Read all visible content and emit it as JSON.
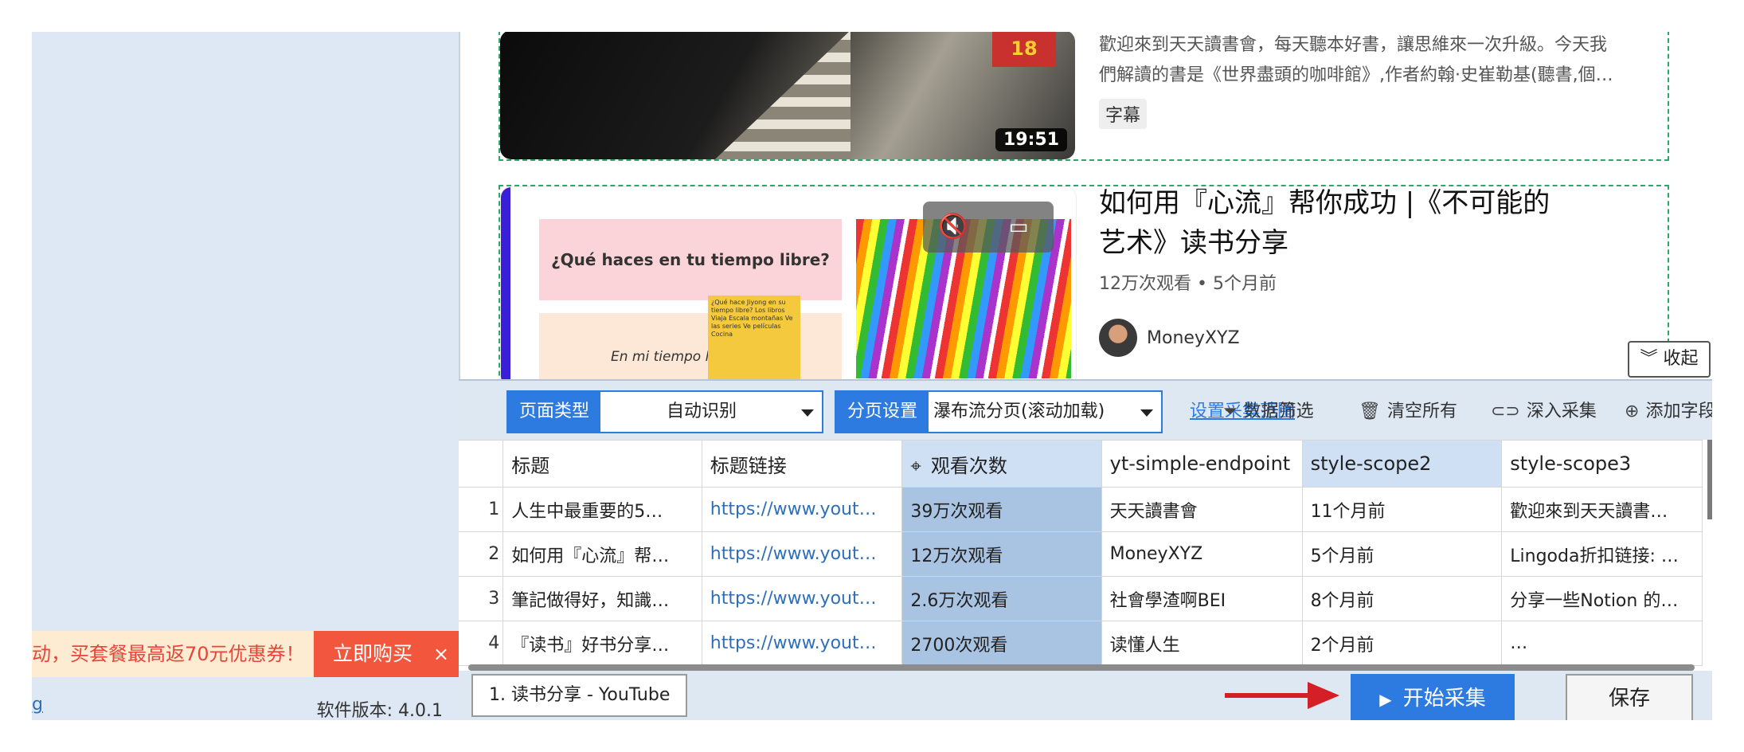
{
  "left_panel": {
    "promo_text": "动，买套餐最高返70元优惠券！",
    "promo_button": "立即购买",
    "promo_close": "×",
    "link_text": "g",
    "version": "软件版本: 4.0.1"
  },
  "videos": [
    {
      "duration": "19:51",
      "book_badge": "18",
      "description_line1": "歡迎來到天天讀書會，每天聽本好書，讓思維來一次升級。今天我",
      "description_line2": "們解讀的書是《世界盡頭的咖啡館》,作者約翰·史崔勒基(聽書,個…",
      "tag": "字幕"
    },
    {
      "title_line1": "如何用『心流』帮你成功 |《不可能的",
      "title_line2": "艺术》读书分享",
      "views": "12万次观看",
      "age": "• 5个月前",
      "channel": "MoneyXYZ",
      "slide_question": "¿Qué haces en tu tiempo libre?",
      "slide_answer": "En mi tiempo li",
      "note_text": "¿Qué hace Jiyong en su tiempo libre? Los libros Viaja Escala montañas Ve las series Ve películas Cocina"
    }
  ],
  "collapse_button": "收起",
  "toolbar": {
    "page_type_label": "页面类型",
    "page_type_value": "自动识别",
    "paging_label": "分页设置",
    "paging_value": "瀑布流分页(滚动加载)",
    "settings_link": "设置采集范围",
    "filter": "数据筛选",
    "clear": "清空所有",
    "deep": "深入采集",
    "add_field": "添加字段"
  },
  "table": {
    "columns": [
      "",
      "标题",
      "标题链接",
      "观看次数",
      "yt-simple-endpoint",
      "style-scope2",
      "style-scope3"
    ],
    "rows": [
      [
        "1",
        "人生中最重要的5…",
        "https://www.yout…",
        "39万次观看",
        "天天讀書會",
        "11个月前",
        "歡迎來到天天讀書…"
      ],
      [
        "2",
        "如何用『心流』帮…",
        "https://www.yout…",
        "12万次观看",
        "MoneyXYZ",
        "5个月前",
        "Lingoda折扣链接: …"
      ],
      [
        "3",
        "筆記做得好，知識…",
        "https://www.yout…",
        "2.6万次观看",
        "社會學渣啊BEI",
        "8个月前",
        "分享一些Notion 的…"
      ],
      [
        "4",
        "『读书』好书分享…",
        "https://www.yout…",
        "2700次观看",
        "读懂人生",
        "2个月前",
        "…"
      ]
    ]
  },
  "bottom": {
    "task_tab": "1. 读书分享 - YouTube",
    "start_button": "开始采集",
    "save_button": "保存"
  },
  "colors": {
    "accent": "#2d7be0",
    "promo_red": "#f2563d",
    "dashed_green": "#2aa86a",
    "selected_column": "#a9c3e2",
    "arrow_red": "#d41f26"
  }
}
